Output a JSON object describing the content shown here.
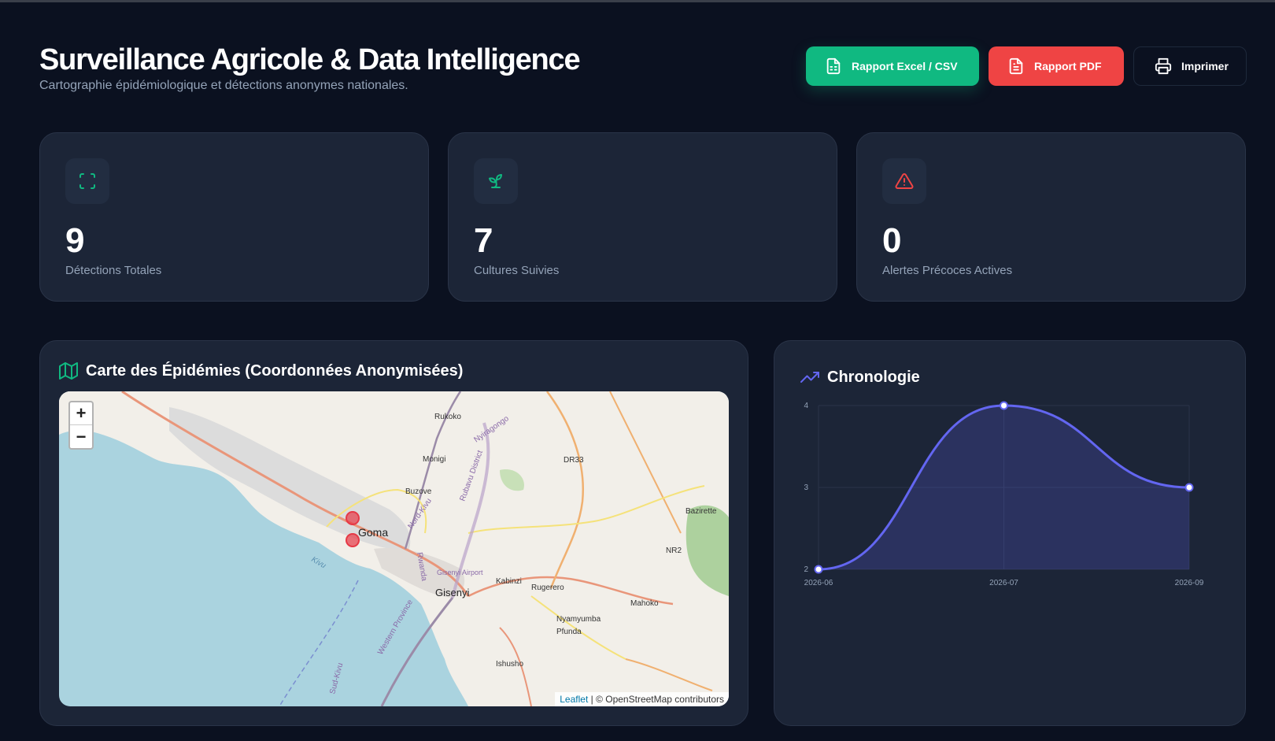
{
  "header": {
    "title": "Surveillance Agricole & Data Intelligence",
    "subtitle": "Cartographie épidémiologique et détections anonymes nationales."
  },
  "actions": {
    "excel_label": "Rapport Excel / CSV",
    "pdf_label": "Rapport PDF",
    "print_label": "Imprimer"
  },
  "colors": {
    "background": "#0b1120",
    "card": "#1c2537",
    "green": "#10b981",
    "red": "#ef4444",
    "indigo": "#6366f1",
    "marker": "#e63946"
  },
  "stats": [
    {
      "icon": "scan-icon",
      "value": "9",
      "label": "Détections Totales"
    },
    {
      "icon": "sprout-icon",
      "value": "7",
      "label": "Cultures Suivies"
    },
    {
      "icon": "alert-triangle-icon",
      "value": "0",
      "label": "Alertes Précoces Actives"
    }
  ],
  "map_panel": {
    "title": "Carte des Épidémies (Coordonnées Anonymisées)",
    "zoom_in": "+",
    "zoom_out": "−",
    "attribution_link": "Leaflet",
    "attribution_text": "| © OpenStreetMap contributors",
    "places": [
      "Rukoko",
      "Monigi",
      "Buzove",
      "Goma",
      "Gisenyi",
      "Kabinzi",
      "Rugerero",
      "Nyamyumba",
      "Pfunda",
      "Ishusho",
      "Mahoko",
      "Bazirette",
      "DR33",
      "NR2",
      "Nyiragongo",
      "Rubavu District",
      "Nord-Kivu",
      "Rwanda",
      "Western Province",
      "Sud-Kivu",
      "Gisenyi Airport",
      "Kivu"
    ]
  },
  "chart_panel": {
    "title": "Chronologie"
  },
  "chart_data": {
    "type": "area",
    "categories": [
      "2026-06",
      "2026-07",
      "2026-09"
    ],
    "values": [
      2,
      4,
      3
    ],
    "ylim": [
      2,
      4
    ],
    "yticks": [
      "2",
      "3",
      "4"
    ],
    "grid": true,
    "legend": "none"
  }
}
